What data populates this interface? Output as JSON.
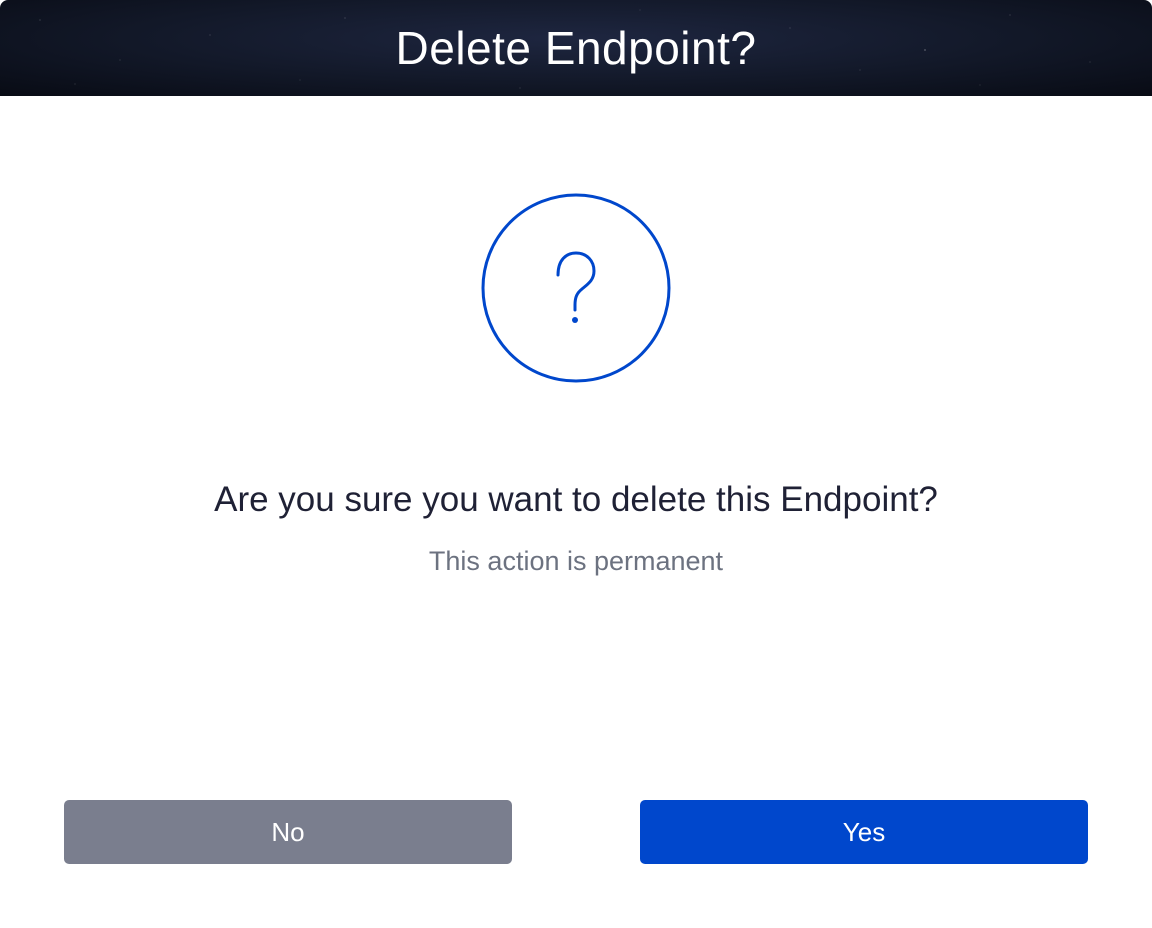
{
  "dialog": {
    "title": "Delete Endpoint?",
    "icon": "question-mark-circle-icon",
    "message": "Are you sure you want to delete this Endpoint?",
    "submessage": "This action is permanent",
    "buttons": {
      "no_label": "No",
      "yes_label": "Yes"
    }
  },
  "colors": {
    "accent": "#0047cc",
    "secondary_button": "#7a7e8e",
    "text_primary": "#1f2135",
    "text_secondary": "#6c7280",
    "header_background": "#121828"
  }
}
